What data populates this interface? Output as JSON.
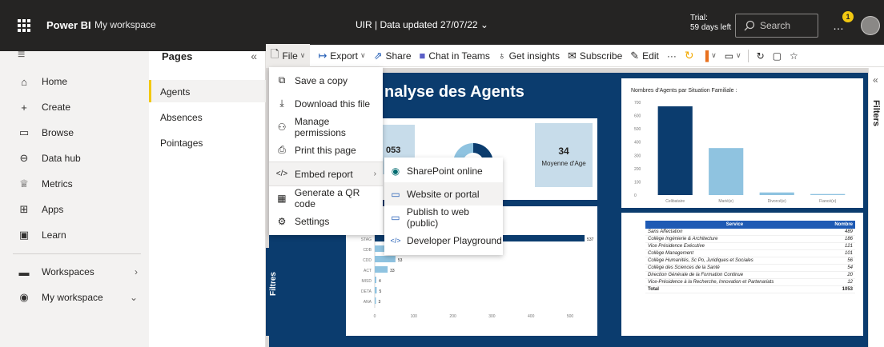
{
  "topbar": {
    "brand": "Power BI",
    "workspace": "My workspace",
    "report_title": "UIR  |  Data updated 27/07/22",
    "trial_line1": "Trial:",
    "trial_line2": "59 days left",
    "search_placeholder": "Search",
    "notification_count": "1"
  },
  "leftnav": {
    "items": [
      {
        "label": "Home",
        "icon": "home-icon"
      },
      {
        "label": "Create",
        "icon": "plus-icon"
      },
      {
        "label": "Browse",
        "icon": "folder-icon"
      },
      {
        "label": "Data hub",
        "icon": "database-icon"
      },
      {
        "label": "Metrics",
        "icon": "trophy-icon"
      },
      {
        "label": "Apps",
        "icon": "apps-icon"
      },
      {
        "label": "Learn",
        "icon": "book-icon"
      },
      {
        "label": "Workspaces",
        "icon": "workspaces-icon"
      },
      {
        "label": "My workspace",
        "icon": "avatar-icon"
      }
    ]
  },
  "pages": {
    "header": "Pages",
    "items": [
      "Agents",
      "Absences",
      "Pointages"
    ],
    "active": "Agents"
  },
  "toolbar": {
    "file": "File",
    "export": "Export",
    "share": "Share",
    "chat": "Chat in Teams",
    "insights": "Get insights",
    "subscribe": "Subscribe",
    "edit": "Edit",
    "more": "···"
  },
  "file_menu": {
    "items": [
      "Save a copy",
      "Download this file",
      "Manage permissions",
      "Print this page",
      "Embed report",
      "Generate a QR code",
      "Settings"
    ]
  },
  "embed_submenu": {
    "items": [
      "SharePoint online",
      "Website or portal",
      "Publish to web (public)",
      "Developer Playground"
    ]
  },
  "report": {
    "title": "nalyse des Agents",
    "kpi_left_value": "053",
    "kpi_right_value": "34",
    "kpi_right_label": "Moyenne d'Age",
    "filtres_label": "Filtres",
    "filters_pane_label": "Filters"
  },
  "chart_data": [
    {
      "type": "bar",
      "title": "Nombres d'Agents par Situation Familiale :",
      "categories": [
        "Celibataire",
        "Marié(e)",
        "Divorcé(e)",
        "Fiancé(e)"
      ],
      "values": [
        670,
        355,
        20,
        8
      ],
      "ylim": [
        0,
        700
      ],
      "yticks": [
        "0",
        "100",
        "200",
        "300",
        "400",
        "500",
        "600",
        "700"
      ]
    },
    {
      "type": "bar",
      "orientation": "horizontal",
      "categories": [
        "STAG",
        "CDB",
        "CDD",
        "ACT",
        "MISD",
        "DETA",
        "ANA"
      ],
      "values": [
        537,
        154,
        53,
        33,
        4,
        5,
        3
      ],
      "data_labels": [
        "537",
        "154",
        "53",
        "33",
        "4",
        "5",
        "3"
      ],
      "xlim": [
        0,
        500
      ],
      "xticks": [
        "0",
        "100",
        "200",
        "300",
        "400",
        "500"
      ]
    }
  ],
  "table": {
    "headers": [
      "Service",
      "Nombre"
    ],
    "rows": [
      [
        "Sans Affectation",
        "489"
      ],
      [
        "Collège Ingénierie & Architecture",
        "186"
      ],
      [
        "Vice Présidence Exécutive",
        "121"
      ],
      [
        "Collège Management",
        "101"
      ],
      [
        "Collège Humanités, Sc Po, Juridiques et Sociales",
        "56"
      ],
      [
        "Collège des Sciences de la Santé",
        "54"
      ],
      [
        "Direction Générale de la Formation Continue",
        "20"
      ],
      [
        "Vice-Présidence à la Recherche, Innovation et Partenariats",
        "12"
      ]
    ],
    "total_label": "Total",
    "total_value": "1053"
  },
  "colors": {
    "topbar": "#252423",
    "accent": "#f2c811",
    "report_bg": "#0b3c6e",
    "bar_dark": "#0b3c6e",
    "bar_light": "#8fc3e0"
  }
}
